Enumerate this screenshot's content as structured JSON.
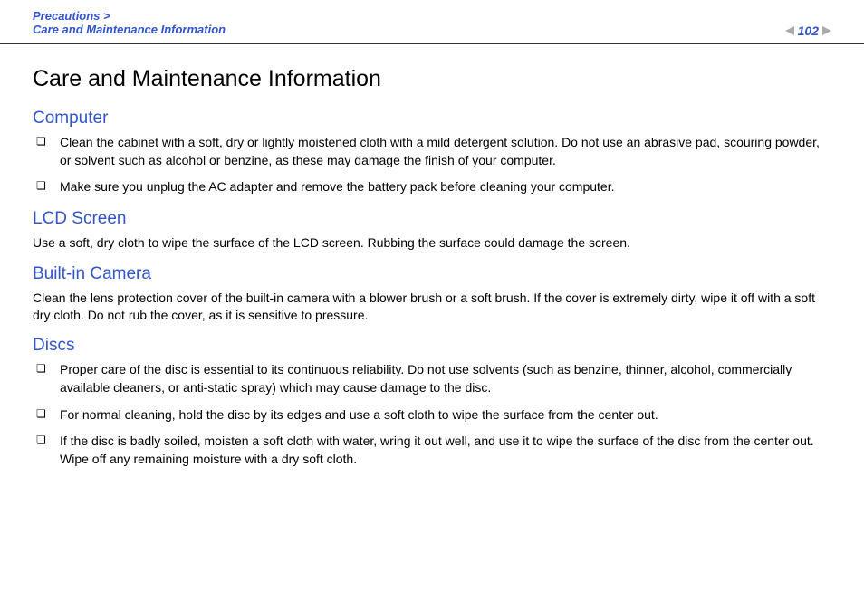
{
  "header": {
    "breadcrumb_parent": "Precautions >",
    "breadcrumb_current": "Care and Maintenance Information",
    "page_number": "102"
  },
  "main_title": "Care and Maintenance Information",
  "sections": {
    "computer": {
      "heading": "Computer",
      "bullets": [
        "Clean the cabinet with a soft, dry or lightly moistened cloth with a mild detergent solution. Do not use an abrasive pad, scouring powder, or solvent such as alcohol or benzine, as these may damage the finish of your computer.",
        "Make sure you unplug the AC adapter and remove the battery pack before cleaning your computer."
      ]
    },
    "lcd": {
      "heading": "LCD Screen",
      "text": "Use a soft, dry cloth to wipe the surface of the LCD screen. Rubbing the surface could damage the screen."
    },
    "camera": {
      "heading": "Built-in Camera",
      "text": "Clean the lens protection cover of the built-in camera with a blower brush or a soft brush. If the cover is extremely dirty, wipe it off with a soft dry cloth. Do not rub the cover, as it is sensitive to pressure."
    },
    "discs": {
      "heading": "Discs",
      "bullets": [
        "Proper care of the disc is essential to its continuous reliability. Do not use solvents (such as benzine, thinner, alcohol, commercially available cleaners, or anti-static spray) which may cause damage to the disc.",
        "For normal cleaning, hold the disc by its edges and use a soft cloth to wipe the surface from the center out.",
        "If the disc is badly soiled, moisten a soft cloth with water, wring it out well, and use it to wipe the surface of the disc from the center out. Wipe off any remaining moisture with a dry soft cloth."
      ]
    }
  }
}
